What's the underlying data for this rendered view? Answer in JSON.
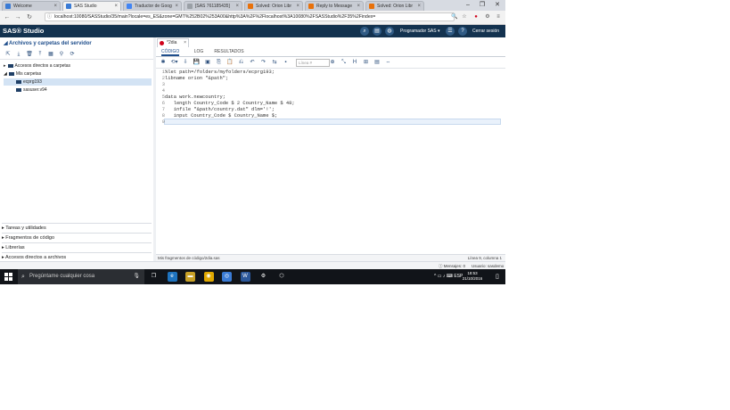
{
  "browser": {
    "tabs": [
      {
        "label": "Welcome",
        "favicon_color": "#3a7bd5",
        "active": false
      },
      {
        "label": "SAS Studio",
        "favicon_color": "#3a7bd5",
        "active": true
      },
      {
        "label": "Traductor de Goog",
        "favicon_color": "#4285f4",
        "active": false
      },
      {
        "label": "[SAS 761185435]",
        "favicon_color": "#9aa0a6",
        "active": false
      },
      {
        "label": "Solved: Orion Libr",
        "favicon_color": "#e8710a",
        "active": false
      },
      {
        "label": "Reply to Message",
        "favicon_color": "#e8710a",
        "active": false
      },
      {
        "label": "Solved: Orion Libr",
        "favicon_color": "#e8710a",
        "active": false
      }
    ],
    "tab_close_glyph": "×",
    "url": "localhost:10080/SASStudio/35/main?locale=es_ES&zone=GMT%252B02%253A00&http%3A%2F%2Flocalhost%3A10080%2FSASStudio%2F35%2Findex=",
    "lock_glyph": "ⓘ",
    "window_controls": [
      "–",
      "❐",
      "✕"
    ],
    "nav_glyphs": [
      "←",
      "→",
      "↻"
    ],
    "address_icons": [
      "🔍",
      "☆",
      "●",
      "⚙",
      "≡"
    ]
  },
  "sas_header": {
    "logo": "SAS® Studio",
    "icons": [
      "⌕",
      "▤",
      "◍"
    ],
    "programmer_label": "Programador SAS ▾",
    "menu_icon": "☰",
    "help_icon": "?",
    "logout_label": "Cerrar sesión"
  },
  "left_panel": {
    "title": "◢ Archivos y carpetas del servidor",
    "toolbar_icons": [
      "⇱",
      "⤓",
      "🗑",
      "⤒",
      "▦",
      "⚲",
      "⟳"
    ],
    "tree": [
      {
        "label": "Accesos directos a carpetas",
        "level": 0,
        "expander": "▸",
        "selected": false,
        "kind": "shortcut"
      },
      {
        "label": "Mis carpetas",
        "level": 0,
        "expander": "◢",
        "selected": false,
        "kind": "home"
      },
      {
        "label": "ecprg193",
        "level": 1,
        "expander": "",
        "selected": true,
        "kind": "folder"
      },
      {
        "label": "sasuser.v94",
        "level": 1,
        "expander": "",
        "selected": false,
        "kind": "folder"
      }
    ],
    "accordion": [
      "▸ Tareas y utilidades",
      "▸ Fragmentos de código",
      "▸ Librerías",
      "▸ Accesos directos a archivos"
    ]
  },
  "editor": {
    "program_tab": "*2dia",
    "subtabs": [
      "CÓDIGO",
      "LOG",
      "RESULTADOS"
    ],
    "active_subtab": 0,
    "toolbar_icons": [
      "✱",
      "⟲▾",
      "⇩",
      "💾",
      "▣",
      "⎘",
      "📋",
      "⎌",
      "↶",
      "↷",
      "⇆",
      "▪"
    ],
    "line_box_placeholder": "Línea #",
    "right_toolbar_icons": [
      "⊕",
      "⤡",
      "H",
      "⊞",
      "▤",
      "⇔"
    ],
    "lines": [
      {
        "n": "1",
        "text": "%let path=/folders/myfolders/ecprg193;"
      },
      {
        "n": "2",
        "text": "libname orion \"&path\";"
      },
      {
        "n": "3",
        "text": ""
      },
      {
        "n": "4",
        "text": ""
      },
      {
        "n": "5",
        "text": "data work.newcountry;"
      },
      {
        "n": "6",
        "text": "   length Country_Code $ 2 Country_Name $ 48;"
      },
      {
        "n": "7",
        "text": "   infile \"&path/country.dat\" dlm='!';"
      },
      {
        "n": "8",
        "text": "   input Country_Code $ Country_Name $;"
      },
      {
        "n": "9",
        "text": ""
      }
    ],
    "current_line": 9,
    "status_left": "Mis fragmentos de código/2dia.sas",
    "status_right": "Línea 9, columna 1"
  },
  "footer": {
    "messages": "ⓘ Mensajes: 0",
    "user": "Usuario: sasdemo"
  },
  "taskbar": {
    "search_placeholder": "Pregúntame cualquier cosa",
    "apps": [
      {
        "glyph": "❐",
        "color": "transparent"
      },
      {
        "glyph": "e",
        "color": "#1e73be"
      },
      {
        "glyph": "▬",
        "color": "#c9a227"
      },
      {
        "glyph": "◉",
        "color": "#e0a800"
      },
      {
        "glyph": "◎",
        "color": "#3a7bd5"
      },
      {
        "glyph": "W",
        "color": "#2b579a"
      },
      {
        "glyph": "⚙",
        "color": "transparent"
      },
      {
        "glyph": "⬡",
        "color": "transparent"
      }
    ],
    "tray": "^  ▭  ♪  ⌨  ESP",
    "time": "18:53",
    "date": "21/10/2016",
    "notif_glyph": "▯"
  }
}
